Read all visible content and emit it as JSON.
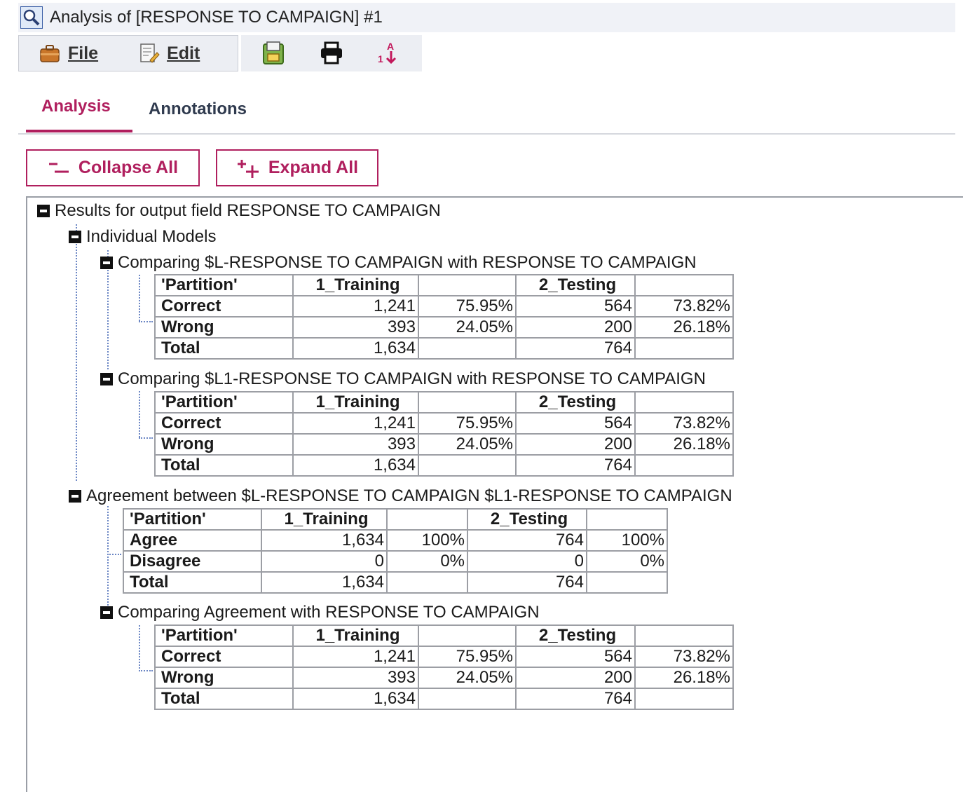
{
  "window": {
    "title": "Analysis of [RESPONSE TO CAMPAIGN] #1",
    "icon": "magnifier-icon"
  },
  "menu": {
    "file_label": "File",
    "edit_label": "Edit",
    "toolbar_icons": [
      "export-icon",
      "print-icon",
      "sort-icon"
    ]
  },
  "tabs": {
    "analysis": "Analysis",
    "annotations": "Annotations",
    "active": "Analysis"
  },
  "buttons": {
    "collapse_all": "Collapse All",
    "expand_all": "Expand All"
  },
  "colors": {
    "accent": "#b01f5e",
    "tree_line": "#6b86c4"
  },
  "tree": {
    "root": "Results for output field RESPONSE TO CAMPAIGN",
    "individual_models": "Individual Models",
    "comparisons": [
      {
        "label": "Comparing $L-RESPONSE TO CAMPAIGN with RESPONSE TO CAMPAIGN",
        "header": [
          "'Partition'",
          "1_Training",
          "",
          "2_Testing",
          ""
        ],
        "rows": [
          [
            "Correct",
            "1,241",
            "75.95%",
            "564",
            "73.82%"
          ],
          [
            "Wrong",
            "393",
            "24.05%",
            "200",
            "26.18%"
          ],
          [
            "Total",
            "1,634",
            "",
            "764",
            ""
          ]
        ]
      },
      {
        "label": "Comparing $L1-RESPONSE TO CAMPAIGN with RESPONSE TO CAMPAIGN",
        "header": [
          "'Partition'",
          "1_Training",
          "",
          "2_Testing",
          ""
        ],
        "rows": [
          [
            "Correct",
            "1,241",
            "75.95%",
            "564",
            "73.82%"
          ],
          [
            "Wrong",
            "393",
            "24.05%",
            "200",
            "26.18%"
          ],
          [
            "Total",
            "1,634",
            "",
            "764",
            ""
          ]
        ]
      }
    ],
    "agreement": {
      "label": "Agreement between  $L-RESPONSE TO CAMPAIGN $L1-RESPONSE TO CAMPAIGN",
      "header": [
        "'Partition'",
        "1_Training",
        "",
        "2_Testing",
        ""
      ],
      "rows": [
        [
          "Agree",
          "1,634",
          "100%",
          "764",
          "100%"
        ],
        [
          "Disagree",
          "0",
          "0%",
          "0",
          "0%"
        ],
        [
          "Total",
          "1,634",
          "",
          "764",
          ""
        ]
      ]
    },
    "agreement_comparison": {
      "label": "Comparing Agreement with RESPONSE TO CAMPAIGN",
      "header": [
        "'Partition'",
        "1_Training",
        "",
        "2_Testing",
        ""
      ],
      "rows": [
        [
          "Correct",
          "1,241",
          "75.95%",
          "564",
          "73.82%"
        ],
        [
          "Wrong",
          "393",
          "24.05%",
          "200",
          "26.18%"
        ],
        [
          "Total",
          "1,634",
          "",
          "764",
          ""
        ]
      ]
    }
  }
}
